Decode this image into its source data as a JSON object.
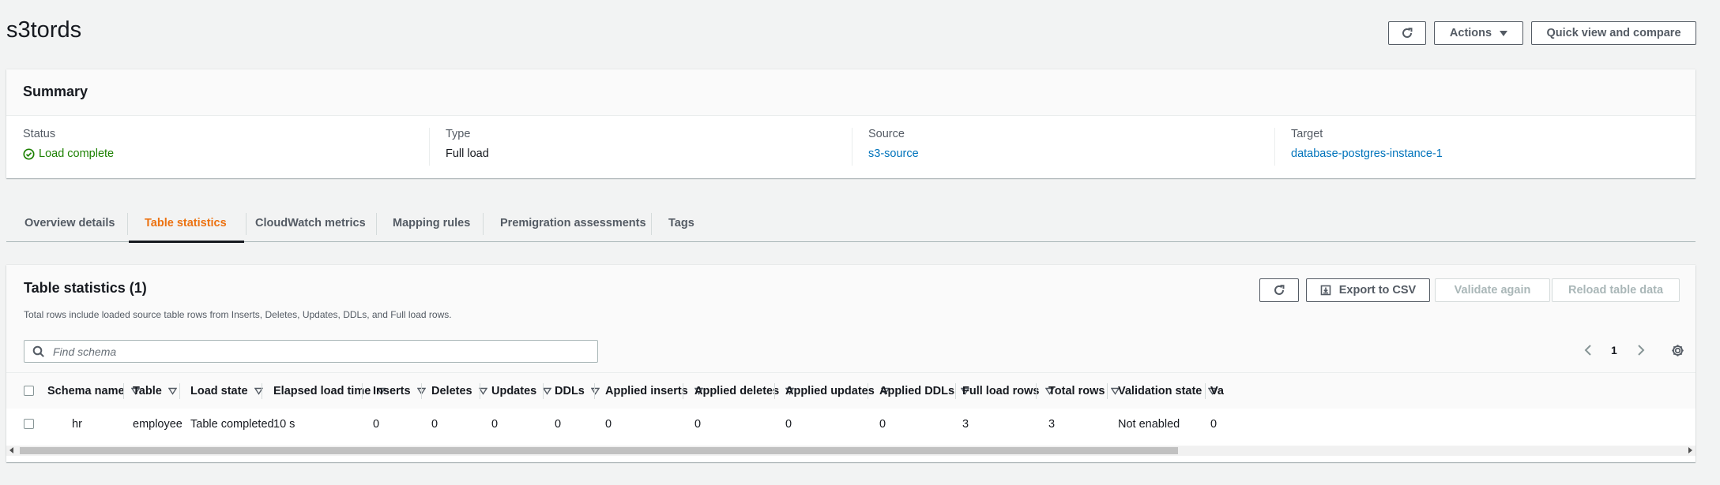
{
  "header": {
    "title": "s3tords",
    "refresh_icon": "refresh-icon",
    "actions_label": "Actions",
    "quick_view_label": "Quick view and compare"
  },
  "summary": {
    "title": "Summary",
    "columns": [
      {
        "label": "Status",
        "value": "Load complete",
        "icon": "check-circle-icon"
      },
      {
        "label": "Type",
        "value": "Full load"
      },
      {
        "label": "Source",
        "value": "s3-source"
      },
      {
        "label": "Target",
        "value": "database-postgres-instance-1"
      }
    ]
  },
  "tabs": [
    {
      "label": "Overview details"
    },
    {
      "label": "Table statistics",
      "active": true
    },
    {
      "label": "CloudWatch metrics"
    },
    {
      "label": "Mapping rules"
    },
    {
      "label": "Premigration assessments"
    },
    {
      "label": "Tags"
    }
  ],
  "table_panel": {
    "title": "Table statistics (1)",
    "description": "Total rows include loaded source table rows from Inserts, Deletes, Updates, DDLs, and Full load rows.",
    "export_label": "Export to CSV",
    "validate_label": "Validate again",
    "reload_label": "Reload table data",
    "search_placeholder": "Find schema",
    "page_number": "1",
    "columns": [
      "Schema name",
      "Table",
      "Load state",
      "Elapsed load time",
      "Inserts",
      "Deletes",
      "Updates",
      "DDLs",
      "Applied inserts",
      "Applied deletes",
      "Applied updates",
      "Applied DDLs",
      "Full load rows",
      "Total rows",
      "Validation state",
      "Va"
    ],
    "rows": [
      [
        "hr",
        "employee",
        "Table completed",
        "10 s",
        "0",
        "0",
        "0",
        "0",
        "0",
        "0",
        "0",
        "0",
        "3",
        "3",
        "Not enabled",
        "0"
      ]
    ]
  },
  "colors": {
    "accent": "#ec7211",
    "link": "#0073bb",
    "success": "#1d8102"
  }
}
